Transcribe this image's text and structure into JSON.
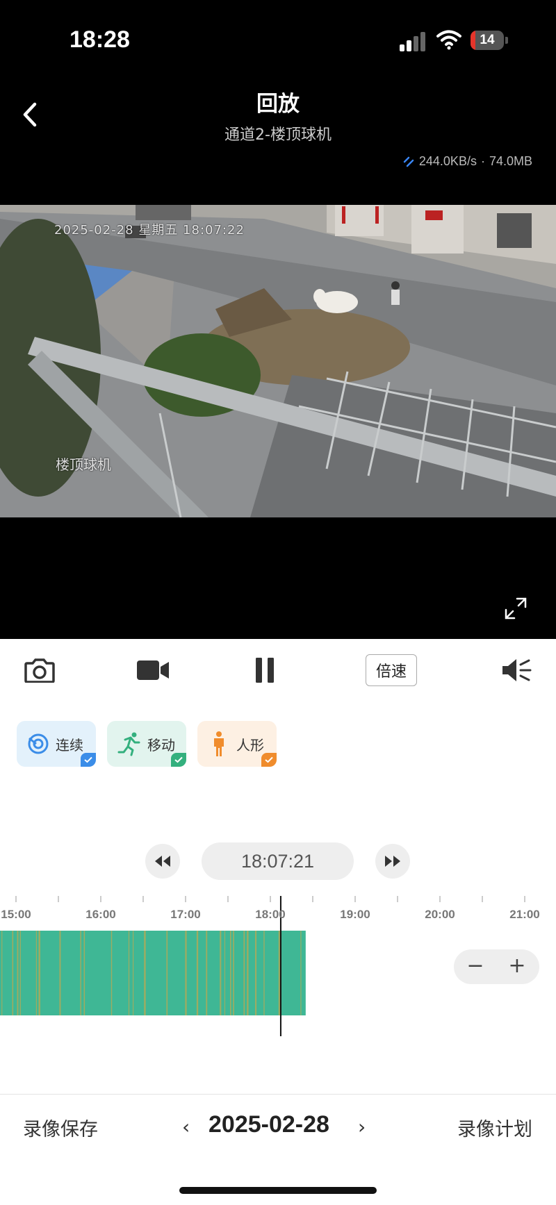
{
  "status_bar": {
    "time": "18:28",
    "battery": "14",
    "battery_level": 0.14
  },
  "header": {
    "title": "回放",
    "channel": "通道2-楼顶球机",
    "rate": "244.0KB/s",
    "separator": "·",
    "size": "74.0MB"
  },
  "video": {
    "osd_datetime": "2025-02-28 星期五 18:07:22",
    "osd_name": "楼顶球机"
  },
  "controls": {
    "speed_label": "倍速"
  },
  "filters": [
    {
      "label": "连续",
      "icon": "continuous-icon",
      "bg": "#e3f1fb",
      "check_color": "#3b8de8"
    },
    {
      "label": "移动",
      "icon": "motion-icon",
      "bg": "#e2f4ee",
      "check_color": "#34b07e"
    },
    {
      "label": "人形",
      "icon": "person-icon",
      "bg": "#fdf0e3",
      "check_color": "#f08c2c"
    }
  ],
  "playback": {
    "current_time": "18:07:21"
  },
  "timeline": {
    "hour_labels": [
      "15:00",
      "16:00",
      "17:00",
      "18:00",
      "19:00",
      "20:00",
      "21:00"
    ],
    "recording_start": "14:41",
    "recording_end": "18:25",
    "cursor_time": "18:07:21",
    "colors": {
      "continuous": "#3fb795",
      "motion": "#c0a850"
    }
  },
  "zoom": {
    "minus": "−",
    "plus": "+"
  },
  "footer": {
    "save_label": "录像保存",
    "plan_label": "录像计划",
    "date": "2025-02-28",
    "prev": "‹",
    "next": "›"
  }
}
